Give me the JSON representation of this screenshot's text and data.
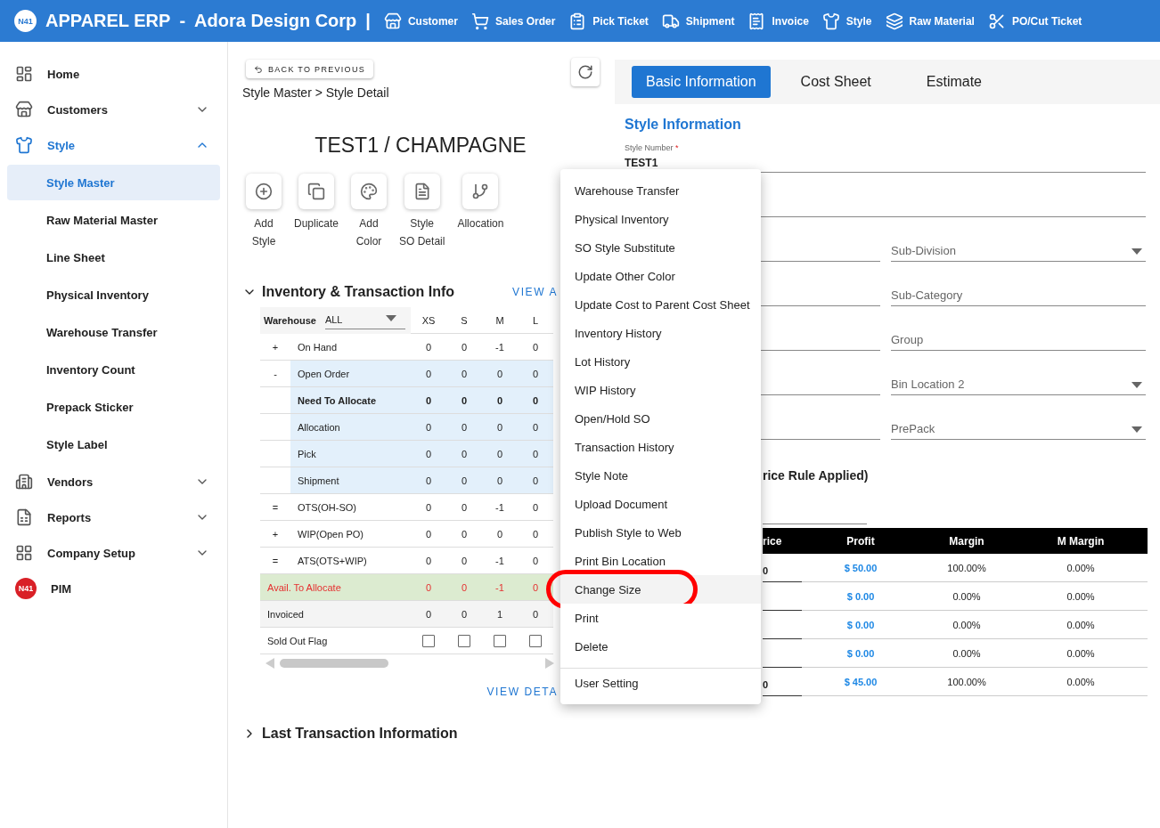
{
  "header": {
    "logo_text": "N41",
    "brand": "APPAREL ERP",
    "separator": "-",
    "company": "Adora Design Corp",
    "divider": "|",
    "nav": [
      {
        "label": "Customer"
      },
      {
        "label": "Sales Order"
      },
      {
        "label": "Pick Ticket"
      },
      {
        "label": "Shipment"
      },
      {
        "label": "Invoice"
      },
      {
        "label": "Style"
      },
      {
        "label": "Raw Material"
      },
      {
        "label": "PO/Cut Ticket"
      }
    ]
  },
  "sidebar": {
    "items": [
      {
        "label": "Home"
      },
      {
        "label": "Customers",
        "expanded": false
      },
      {
        "label": "Style",
        "expanded": true,
        "children": [
          {
            "label": "Style Master",
            "selected": true
          },
          {
            "label": "Raw Material Master",
            "selected": false
          },
          {
            "label": "Line Sheet",
            "selected": false
          },
          {
            "label": "Physical Inventory",
            "selected": false
          },
          {
            "label": "Warehouse Transfer",
            "selected": false
          },
          {
            "label": "Inventory Count",
            "selected": false
          },
          {
            "label": "Prepack Sticker",
            "selected": false
          },
          {
            "label": "Style Label",
            "selected": false
          }
        ]
      },
      {
        "label": "Vendors",
        "expanded": false
      },
      {
        "label": "Reports",
        "expanded": false
      },
      {
        "label": "Company Setup",
        "expanded": false
      },
      {
        "label": "PIM",
        "logo_text": "N41"
      }
    ]
  },
  "detail": {
    "back_button": "BACK TO PREVIOUS",
    "breadcrumb": "Style Master > Style Detail",
    "title": "TEST1 / CHAMPAGNE",
    "actions": [
      {
        "lines": [
          "Add",
          "Style"
        ]
      },
      {
        "lines": [
          "Duplicate"
        ]
      },
      {
        "lines": [
          "Add",
          "Color"
        ]
      },
      {
        "lines": [
          "Style",
          "SO Detail"
        ]
      },
      {
        "lines": [
          "Allocation"
        ]
      }
    ],
    "inventory": {
      "title": "Inventory & Transaction Info",
      "expanded": true,
      "view_all": "VIEW A",
      "warehouse_label": "Warehouse",
      "warehouse_value": "ALL",
      "columns": [
        "XS",
        "S",
        "M",
        "L"
      ],
      "rows": [
        {
          "kind": "plain",
          "sign": "+",
          "label": "On Hand",
          "bold": false,
          "values": [
            "0",
            "0",
            "-1",
            "0"
          ]
        },
        {
          "kind": "order",
          "sign": "-",
          "label": "Open Order",
          "bold": false,
          "values": [
            "0",
            "0",
            "0",
            "0"
          ]
        },
        {
          "kind": "order",
          "label": "Need To Allocate",
          "bold": true,
          "values": [
            "0",
            "0",
            "0",
            "0"
          ]
        },
        {
          "kind": "order",
          "label": "Allocation",
          "bold": false,
          "values": [
            "0",
            "0",
            "0",
            "0"
          ]
        },
        {
          "kind": "order",
          "label": "Pick",
          "bold": false,
          "values": [
            "0",
            "0",
            "0",
            "0"
          ]
        },
        {
          "kind": "order",
          "label": "Shipment",
          "bold": false,
          "values": [
            "0",
            "0",
            "0",
            "0"
          ]
        },
        {
          "kind": "plain",
          "sign": "=",
          "label": "OTS(OH-SO)",
          "bold": false,
          "values": [
            "0",
            "0",
            "-1",
            "0"
          ]
        },
        {
          "kind": "plain",
          "sign": "+",
          "label": "WIP(Open PO)",
          "bold": false,
          "values": [
            "0",
            "0",
            "0",
            "0"
          ]
        },
        {
          "kind": "plain",
          "sign": "=",
          "label": "ATS(OTS+WIP)",
          "bold": false,
          "values": [
            "0",
            "0",
            "-1",
            "0"
          ]
        },
        {
          "kind": "avail",
          "label": "Avail. To Allocate",
          "bold": false,
          "values": [
            "0",
            "0",
            "-1",
            "0"
          ]
        },
        {
          "kind": "invoiced",
          "label": "Invoiced",
          "bold": false,
          "values": [
            "0",
            "0",
            "1",
            "0"
          ]
        }
      ],
      "sold_out": {
        "label": "Sold Out Flag",
        "flags": [
          false,
          false,
          false,
          false
        ]
      },
      "view_details": "VIEW DETA"
    },
    "last_transaction": {
      "title": "Last Transaction Information",
      "expanded": false
    }
  },
  "menu": {
    "items": [
      {
        "label": "Warehouse Transfer",
        "selected": false,
        "circled": false
      },
      {
        "label": "Physical Inventory",
        "selected": false,
        "circled": false
      },
      {
        "label": "SO Style Substitute",
        "selected": false,
        "circled": false
      },
      {
        "label": "Update Other Color",
        "selected": false,
        "circled": false
      },
      {
        "label": "Update Cost to Parent Cost Sheet",
        "selected": false,
        "circled": false
      },
      {
        "label": "Inventory History",
        "selected": false,
        "circled": false
      },
      {
        "label": "Lot History",
        "selected": false,
        "circled": false
      },
      {
        "label": "WIP History",
        "selected": false,
        "circled": false
      },
      {
        "label": "Open/Hold SO",
        "selected": false,
        "circled": false
      },
      {
        "label": "Transaction History",
        "selected": false,
        "circled": false
      },
      {
        "label": "Style Note",
        "selected": false,
        "circled": false
      },
      {
        "label": "Upload Document",
        "selected": false,
        "circled": false
      },
      {
        "label": "Publish Style to Web",
        "selected": false,
        "circled": false
      },
      {
        "label": "Print Bin Location",
        "selected": false,
        "circled": false
      },
      {
        "label": "Change Size",
        "selected": true,
        "circled": true
      },
      {
        "label": "Print",
        "selected": false,
        "circled": false
      },
      {
        "label": "Delete",
        "selected": false,
        "circled": false
      }
    ],
    "footer_items": [
      {
        "label": "User Setting"
      }
    ]
  },
  "right": {
    "tabs": [
      {
        "label": "Basic Information",
        "selected": true
      },
      {
        "label": "Cost Sheet",
        "selected": false
      },
      {
        "label": "Estimate",
        "selected": false
      }
    ],
    "section_title": "Style Information",
    "style_number": {
      "label": "Style Number",
      "required_mark": "*",
      "value": "TEST1"
    },
    "fields": [
      {
        "label": "Sub-Division",
        "dropdown": true
      },
      {
        "label": "Sub-Category",
        "dropdown": false
      },
      {
        "label": "Group",
        "dropdown": false
      },
      {
        "label": "Bin Location 2",
        "dropdown": true
      },
      {
        "label": "PrePack",
        "dropdown": true
      }
    ],
    "price_heading": "rice Rule Applied)",
    "price_table": {
      "columns": [
        "rice",
        "Profit",
        "Margin",
        "M Margin"
      ],
      "rows": [
        [
          "0",
          "$ 50.00",
          "100.00%",
          "0.00%"
        ],
        [
          "",
          "$ 0.00",
          "0.00%",
          "0.00%"
        ],
        [
          "",
          "$ 0.00",
          "0.00%",
          "0.00%"
        ],
        [
          "",
          "$ 0.00",
          "0.00%",
          "0.00%"
        ],
        [
          "0",
          "$ 45.00",
          "100.00%",
          "0.00%"
        ]
      ]
    }
  }
}
